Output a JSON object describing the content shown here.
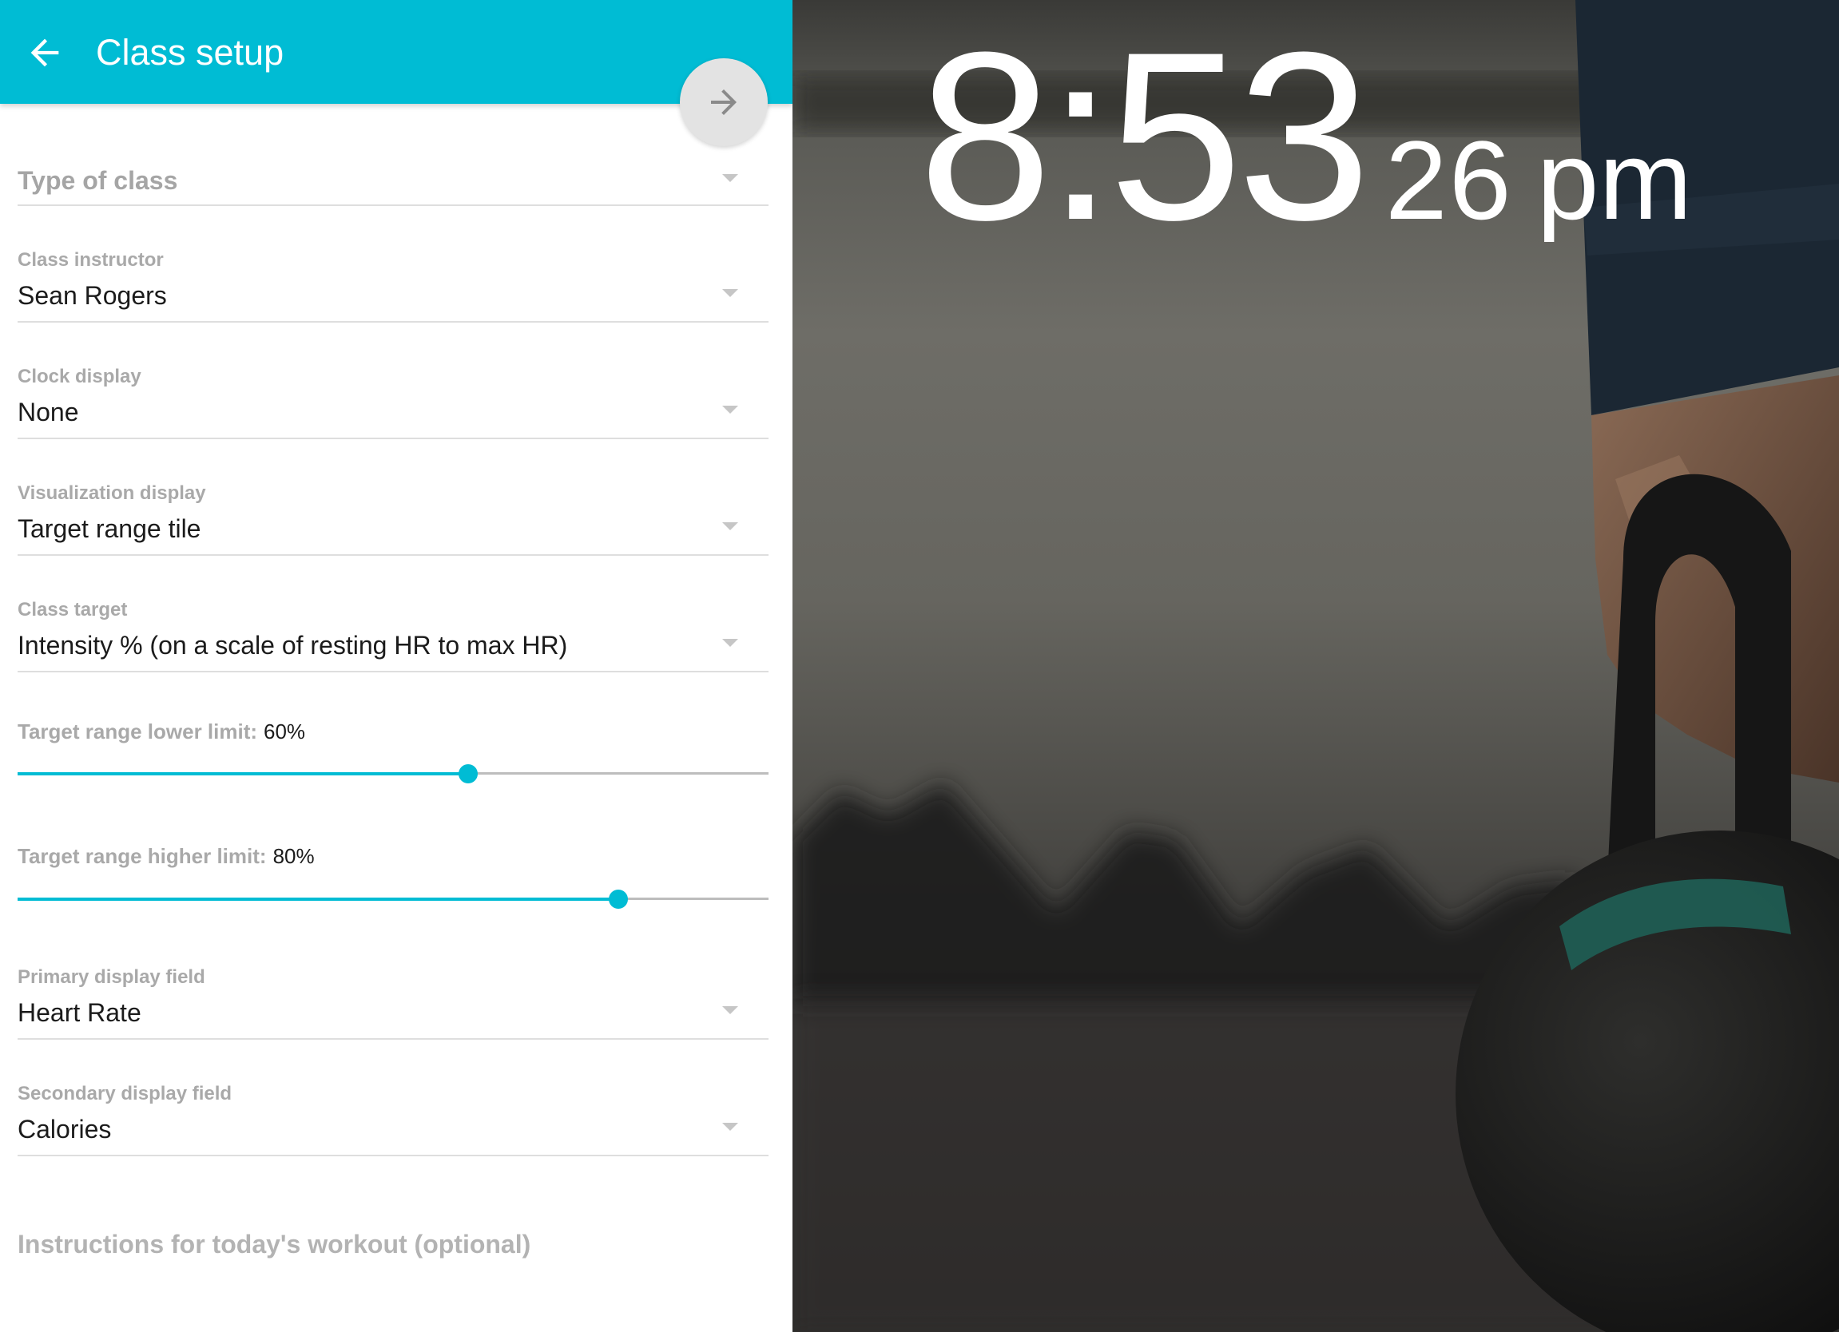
{
  "appbar": {
    "title": "Class setup"
  },
  "fields": {
    "type_of_class": {
      "placeholder": "Type of class"
    },
    "instructor": {
      "label": "Class instructor",
      "value": "Sean Rogers"
    },
    "clock_display": {
      "label": "Clock display",
      "value": "None"
    },
    "visualization": {
      "label": "Visualization display",
      "value": "Target range tile"
    },
    "class_target": {
      "label": "Class target",
      "value": "Intensity % (on a scale of resting HR to max HR)"
    },
    "primary": {
      "label": "Primary display field",
      "value": "Heart Rate"
    },
    "secondary": {
      "label": "Secondary display field",
      "value": "Calories"
    }
  },
  "sliders": {
    "lower": {
      "label": "Target range lower limit:",
      "value": "60%",
      "fraction": 0.6
    },
    "higher": {
      "label": "Target range higher limit:",
      "value": "80%",
      "fraction": 0.8
    }
  },
  "instructions": {
    "placeholder": "Instructions for today's workout (optional)"
  },
  "clock": {
    "hours_minutes": "8:53",
    "seconds": "26",
    "ampm": "pm"
  },
  "colors": {
    "accent": "#00bcd4",
    "label": "#a9a9a9",
    "text": "#1b1b1b"
  }
}
